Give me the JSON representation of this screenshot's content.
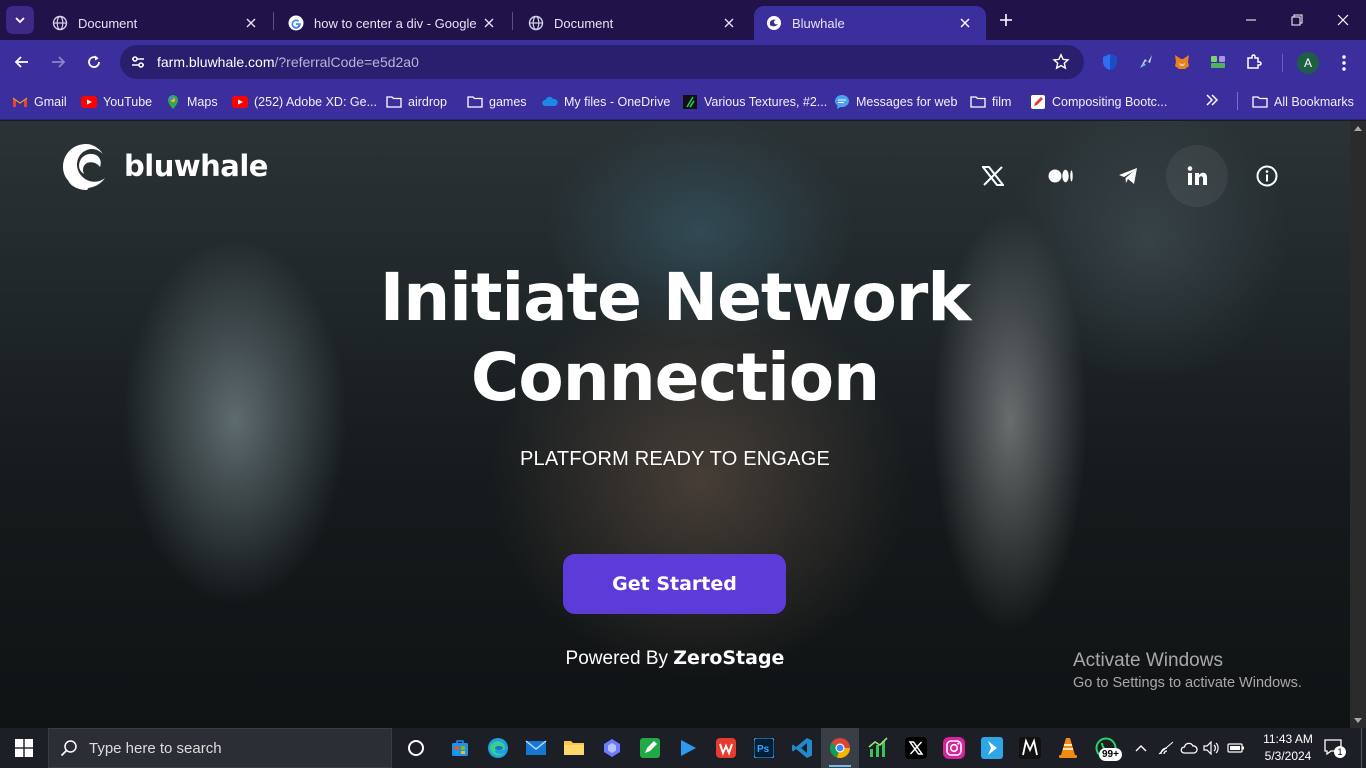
{
  "browser": {
    "tabs": [
      {
        "title": "Document",
        "favicon": "globe-icon",
        "active": false
      },
      {
        "title": "how to center a div - Google Se",
        "favicon": "google-icon",
        "active": false
      },
      {
        "title": "Document",
        "favicon": "globe-icon",
        "active": false
      },
      {
        "title": "Bluwhale",
        "favicon": "bluwhale-icon",
        "active": true
      }
    ],
    "url_host": "farm.bluwhale.com",
    "url_path": "/?referralCode=e5d2a0",
    "profile_initial": "A",
    "accent_color": "#3a2f9d",
    "tabstrip_color": "#21124a"
  },
  "bookmarks": {
    "items": [
      {
        "label": "Gmail",
        "icon": "gmail-icon"
      },
      {
        "label": "YouTube",
        "icon": "youtube-icon"
      },
      {
        "label": "Maps",
        "icon": "maps-icon"
      },
      {
        "label": "(252) Adobe XD: Ge...",
        "icon": "youtube-icon"
      },
      {
        "label": "airdrop",
        "icon": "folder-icon"
      },
      {
        "label": "games",
        "icon": "folder-icon"
      },
      {
        "label": "My files - OneDrive",
        "icon": "onedrive-icon"
      },
      {
        "label": "Various Textures, #2...",
        "icon": "textures-icon"
      },
      {
        "label": "Messages for web",
        "icon": "messages-icon"
      },
      {
        "label": "film",
        "icon": "folder-icon"
      },
      {
        "label": "Compositing Bootc...",
        "icon": "bootcamp-icon"
      }
    ],
    "all_bookmarks": "All Bookmarks"
  },
  "page": {
    "brand": "bluwhale",
    "social": [
      "x-icon",
      "medium-icon",
      "telegram-icon",
      "linkedin-icon",
      "info-icon"
    ],
    "hero_line1": "Initiate Network",
    "hero_line2": "Connection",
    "subtitle": "PLATFORM READY TO ENGAGE",
    "cta_label": "Get Started",
    "powered_prefix": "Powered By ",
    "powered_brand": "ZeroStage",
    "cta_color": "#5d3bd9"
  },
  "watermark": {
    "line1": "Activate Windows",
    "line2": "Go to Settings to activate Windows."
  },
  "taskbar": {
    "search_placeholder": "Type here to search",
    "time": "11:43 AM",
    "date": "5/3/2024",
    "badge": "99+",
    "notifications": "1"
  }
}
